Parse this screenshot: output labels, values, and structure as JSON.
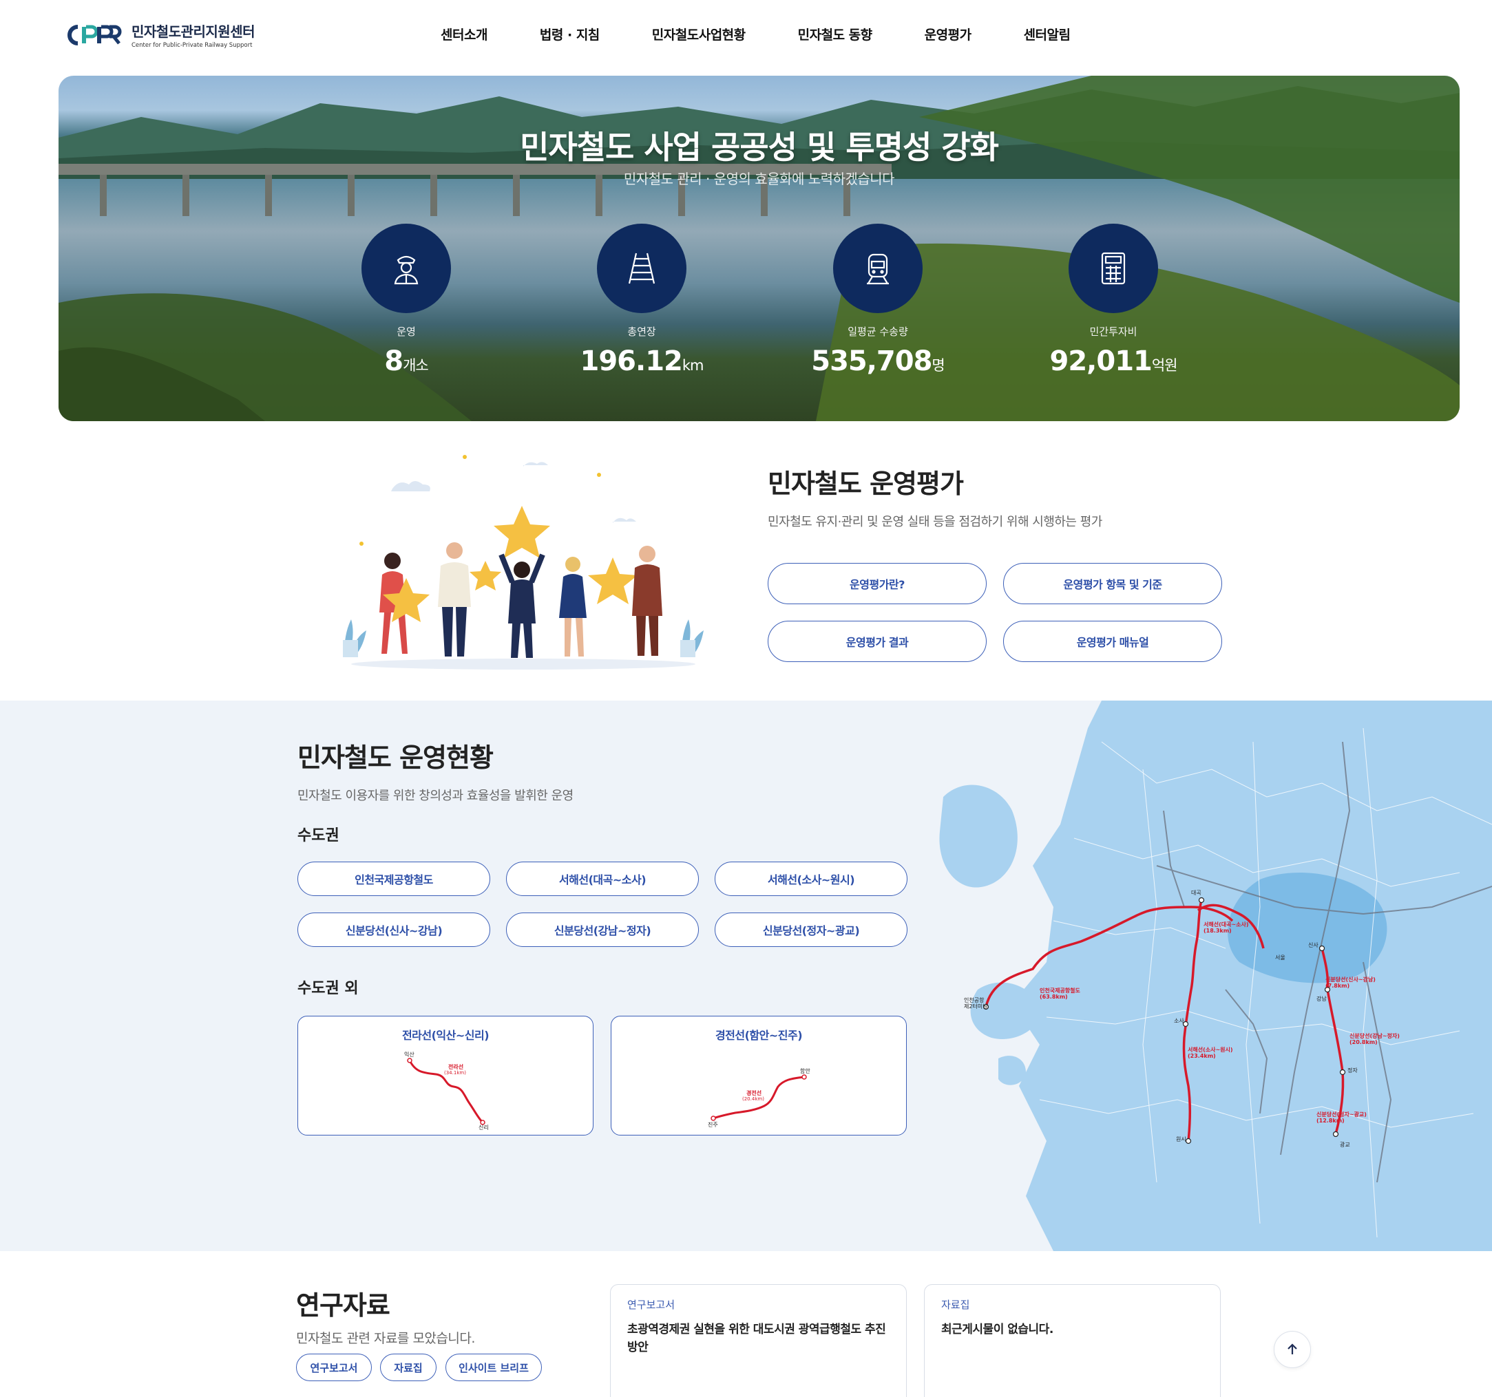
{
  "header": {
    "logo_kr": "민자철도관리지원센터",
    "logo_en": "Center for Public-Private Railway Support",
    "nav": [
      "센터소개",
      "법령 · 지침",
      "민자철도사업현황",
      "민자철도 동향",
      "운영평가",
      "센터알림"
    ]
  },
  "hero": {
    "title": "민자철도 사업 공공성 및 투명성 강화",
    "subtitle": "민자철도 관리 · 운영의 효율화에 노력하겠습니다",
    "stats": [
      {
        "label": "운영",
        "value": "8",
        "unit": "개소",
        "icon": "conductor-icon"
      },
      {
        "label": "총연장",
        "value": "196.12",
        "unit": "km",
        "icon": "railway-track-icon"
      },
      {
        "label": "일평균 수송량",
        "value": "535,708",
        "unit": "명",
        "icon": "train-icon"
      },
      {
        "label": "민간투자비",
        "value": "92,011",
        "unit": "억원",
        "icon": "calculator-icon"
      }
    ]
  },
  "evaluation": {
    "title": "민자철도 운영평가",
    "description": "민자철도 유지·관리 및 운영 실태 등을 점검하기 위해 시행하는 평가",
    "buttons": [
      "운영평가란?",
      "운영평가 항목 및 기준",
      "운영평가 결과",
      "운영평가 매뉴얼"
    ]
  },
  "operations": {
    "title": "민자철도 운영현황",
    "description": "민자철도 이용자를 위한 창의성과 효율성을 발휘한 운영",
    "capital_title": "수도권",
    "capital_lines": [
      "인천국제공항철도",
      "서해선(대곡~소사)",
      "서해선(소사~원시)",
      "신분당선(신사~강남)",
      "신분당선(강남~정자)",
      "신분당선(정자~광교)"
    ],
    "outside_title": "수도권 외",
    "outside_lines": [
      {
        "title": "전라선(익산~신리)",
        "start": "익산",
        "end": "신리",
        "name": "전라선",
        "length": "(34.1km)"
      },
      {
        "title": "경전선(함안~진주)",
        "start": "함안",
        "end": "진주",
        "name": "경전선",
        "length": "(20.4km)"
      }
    ],
    "map_labels": {
      "airport": "인천국제공항철도\n(63.8km)",
      "seohae1": "서해선(대곡~소사)\n(18.3km)",
      "seohae2": "서해선(소사~원시)\n(23.4km)",
      "sbd1": "신분당선(신사~강남)\n(7.8km)",
      "sbd2": "신분당선(강남~정자)\n(20.8km)",
      "sbd3": "신분당선(정자~광교)\n(12.8km)",
      "st_daegok": "대곡",
      "st_sosa": "소사",
      "st_wonsi": "원시",
      "st_sinsa": "신사",
      "st_gangnam": "강남",
      "st_jeongja": "정자",
      "st_gwanggyo": "광교",
      "st_airport": "인천공항\n제2터미널",
      "st_seoul": "서울"
    },
    "colors": {
      "line_red": "#d7192a",
      "map_blue": "#a9d2f0"
    }
  },
  "research": {
    "title": "연구자료",
    "description": "민자철도 관련 자료를 모았습니다.",
    "tags": [
      "연구보고서",
      "자료집",
      "인사이트 브리프"
    ],
    "cards": [
      {
        "category": "연구보고서",
        "text": "초광역경제권 실현을 위한 대도시권 광역급행철도 추진 방안"
      },
      {
        "category": "자료집",
        "text": "최근게시물이 없습니다."
      }
    ]
  }
}
